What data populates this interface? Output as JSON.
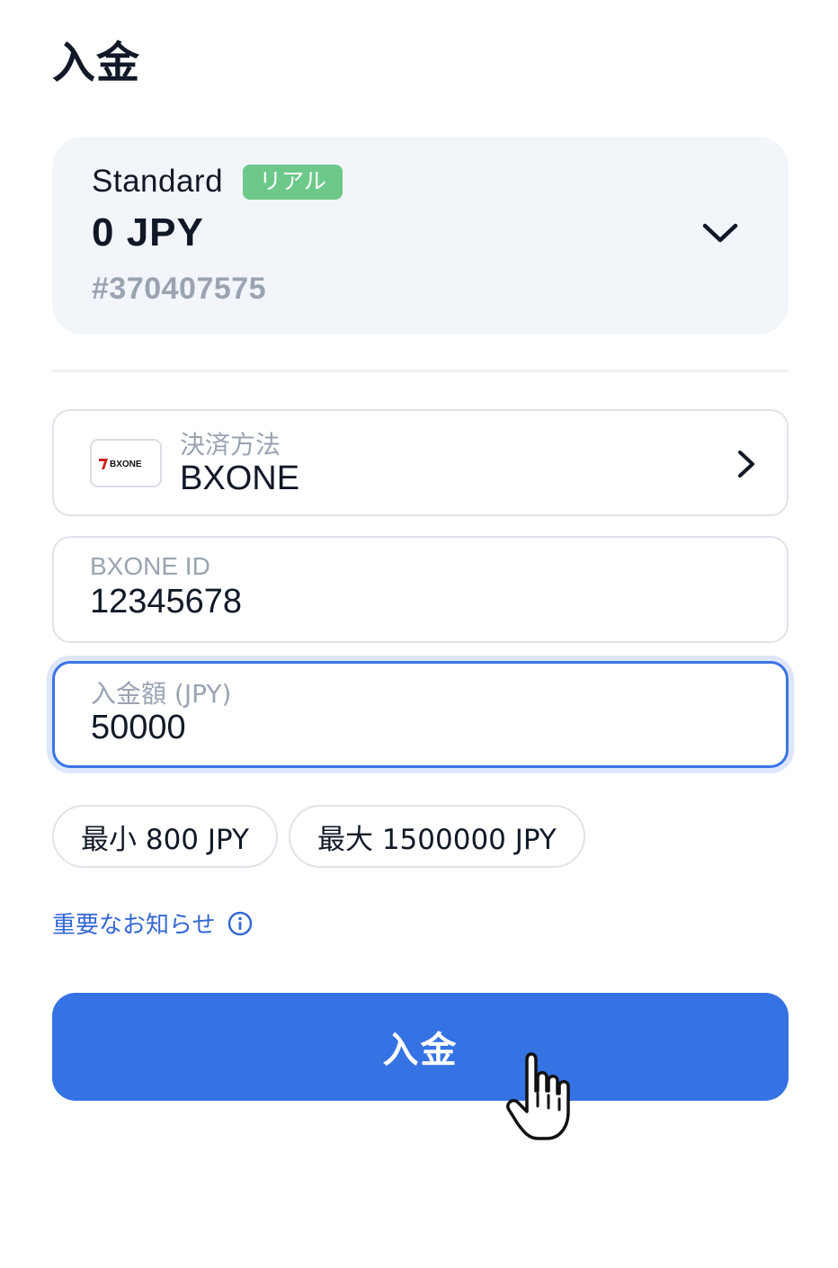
{
  "page": {
    "title": "入金"
  },
  "account": {
    "type": "Standard",
    "badge": "リアル",
    "balance": "0 JPY",
    "number": "#370407575"
  },
  "payment_method": {
    "label": "決済方法",
    "value": "BXONE",
    "logo_text": "BXONE"
  },
  "bxone_id": {
    "label": "BXONE ID",
    "value": "12345678"
  },
  "amount": {
    "label": "入金額 (JPY)",
    "value": "50000"
  },
  "limits": {
    "min": "最小 800 JPY",
    "max": "最大 1500000 JPY"
  },
  "notice": {
    "label": "重要なお知らせ"
  },
  "submit": {
    "label": "入金"
  },
  "colors": {
    "accent": "#3572e4",
    "badge": "#6dc98a",
    "link": "#3568d4",
    "card_bg": "#f2f5fa"
  },
  "icons": {
    "account_dropdown": "chevron-down-icon",
    "payment_select": "chevron-right-icon",
    "notice": "info-icon",
    "cursor": "hand-pointer-icon"
  }
}
